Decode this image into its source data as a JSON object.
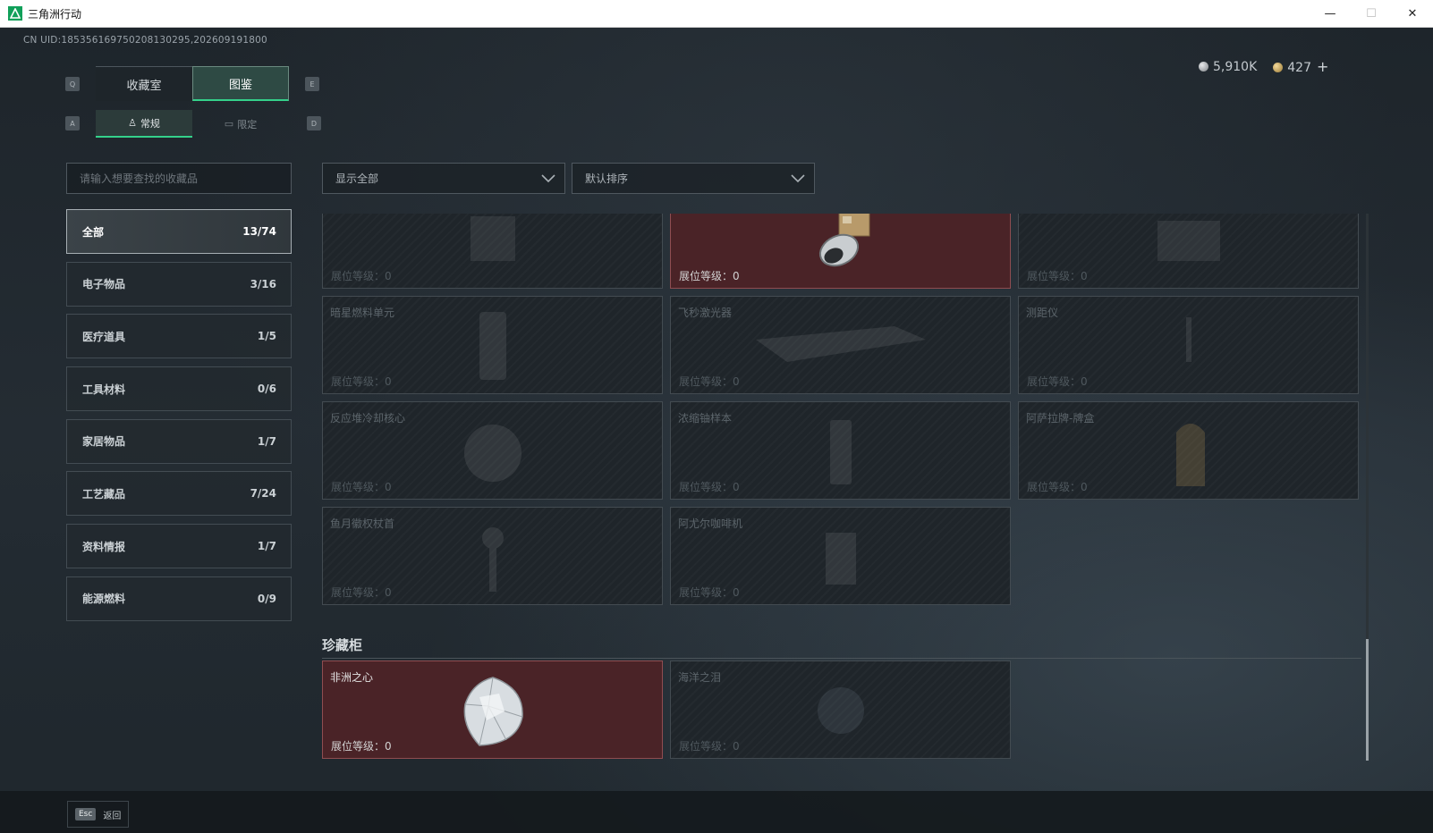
{
  "window": {
    "title": "三角洲行动",
    "minimize": "—",
    "maximize": "☐",
    "close": "✕"
  },
  "uid": "CN UID:1853561697502081302​95,202609191800",
  "currency": {
    "silver": "5,910K",
    "gold": "427",
    "plus": "+"
  },
  "keys": {
    "q": "Q",
    "e": "E",
    "a": "A",
    "d": "D"
  },
  "main_tabs": [
    {
      "label": "收藏室",
      "active": false
    },
    {
      "label": "图鉴",
      "active": true
    }
  ],
  "sub_tabs": [
    {
      "label": "常规",
      "icon": "figure-icon",
      "active": true
    },
    {
      "label": "限定",
      "icon": "image-icon",
      "active": false
    }
  ],
  "search": {
    "placeholder": "请输入想要查找的收藏品"
  },
  "categories": [
    {
      "label": "全部",
      "count": "13/74",
      "active": true
    },
    {
      "label": "电子物品",
      "count": "3/16"
    },
    {
      "label": "医疗道具",
      "count": "1/5"
    },
    {
      "label": "工具材料",
      "count": "0/6"
    },
    {
      "label": "家居物品",
      "count": "1/7"
    },
    {
      "label": "工艺藏品",
      "count": "7/24"
    },
    {
      "label": "资料情报",
      "count": "1/7"
    },
    {
      "label": "能源燃料",
      "count": "0/9"
    }
  ],
  "filters": {
    "display": "显示全部",
    "sort": "默认排序"
  },
  "level_label": "展位等级：",
  "items": [
    {
      "name": "",
      "level": "0",
      "owned": false,
      "icon": "device-icon"
    },
    {
      "name": "",
      "level": "0",
      "owned": true,
      "icon": "lens-icon"
    },
    {
      "name": "",
      "level": "0",
      "owned": false,
      "icon": "machine-icon"
    },
    {
      "name": "暗星燃料单元",
      "level": "0",
      "owned": false,
      "icon": "fuel-cell-icon"
    },
    {
      "name": "飞秒激光器",
      "level": "0",
      "owned": false,
      "icon": "laser-icon"
    },
    {
      "name": "测距仪",
      "level": "0",
      "owned": false,
      "icon": "rangefinder-icon"
    },
    {
      "name": "反应堆冷却核心",
      "level": "0",
      "owned": false,
      "icon": "reactor-core-icon"
    },
    {
      "name": "浓缩铀样本",
      "level": "0",
      "owned": false,
      "icon": "uranium-sample-icon"
    },
    {
      "name": "阿萨拉牌-牌盒",
      "level": "0",
      "owned": false,
      "icon": "card-box-icon"
    },
    {
      "name": "鱼月徽权杖首",
      "level": "0",
      "owned": false,
      "icon": "scepter-icon"
    },
    {
      "name": "阿尤尔咖啡机",
      "level": "0",
      "owned": false,
      "icon": "coffee-machine-icon"
    }
  ],
  "treasure": {
    "title": "珍藏柜",
    "items": [
      {
        "name": "非洲之心",
        "level": "0",
        "owned": true,
        "icon": "diamond-icon"
      },
      {
        "name": "海洋之泪",
        "level": "0",
        "owned": false,
        "icon": "gem-icon"
      }
    ]
  },
  "bottom": {
    "esc_key": "Esc",
    "back_label": "返回"
  }
}
